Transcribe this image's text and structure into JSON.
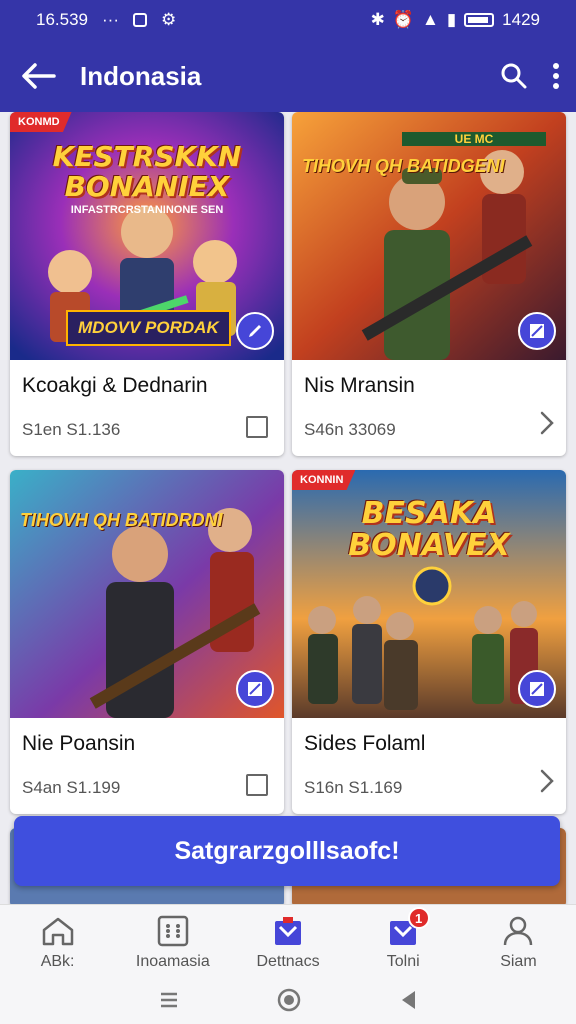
{
  "status_bar": {
    "time": "16.539",
    "dots": "···",
    "battery_pct": "1429"
  },
  "app_bar": {
    "title": "Indonasia"
  },
  "cards": [
    {
      "badge": "KONMD",
      "art_title": "KESTRSKKN BONANIEX",
      "art_sub": "INFASTRCRSTANINONE SEN",
      "art_brand": "MDOVV PORDAK",
      "name": "Kcoakgi & Dednarin",
      "meta": "S1en S1.136",
      "control": "checkbox"
    },
    {
      "badge": "",
      "art_tag": "TIHOVH QH BATIDGENI",
      "art_logo": "UE MC",
      "name": "Nis Mransin",
      "meta": "S46n 33069",
      "control": "chevron"
    },
    {
      "badge": "",
      "art_tag": "TIHOVH QH BATIDRDNI",
      "name": "Nie Poansin",
      "meta": "S4an S1.199",
      "control": "checkbox"
    },
    {
      "badge": "KONNIN",
      "art_title": "BESAKA BONAVEX",
      "name": "Sides Folaml",
      "meta": "S16n S1.169",
      "control": "chevron"
    }
  ],
  "cta": {
    "label": "Satgrarzgolllsaofc!"
  },
  "bottom_nav": [
    {
      "label": "ABk:",
      "icon": "home-icon"
    },
    {
      "label": "Inoamasia",
      "icon": "grid-icon"
    },
    {
      "label": "Dettnacs",
      "icon": "bag-icon"
    },
    {
      "label": "Tolni",
      "icon": "bag-icon",
      "badge": "1"
    },
    {
      "label": "Siam",
      "icon": "person-icon"
    }
  ],
  "colors": {
    "primary": "#3535a8",
    "accent": "#3f4fde",
    "badge": "#e02b2b"
  }
}
